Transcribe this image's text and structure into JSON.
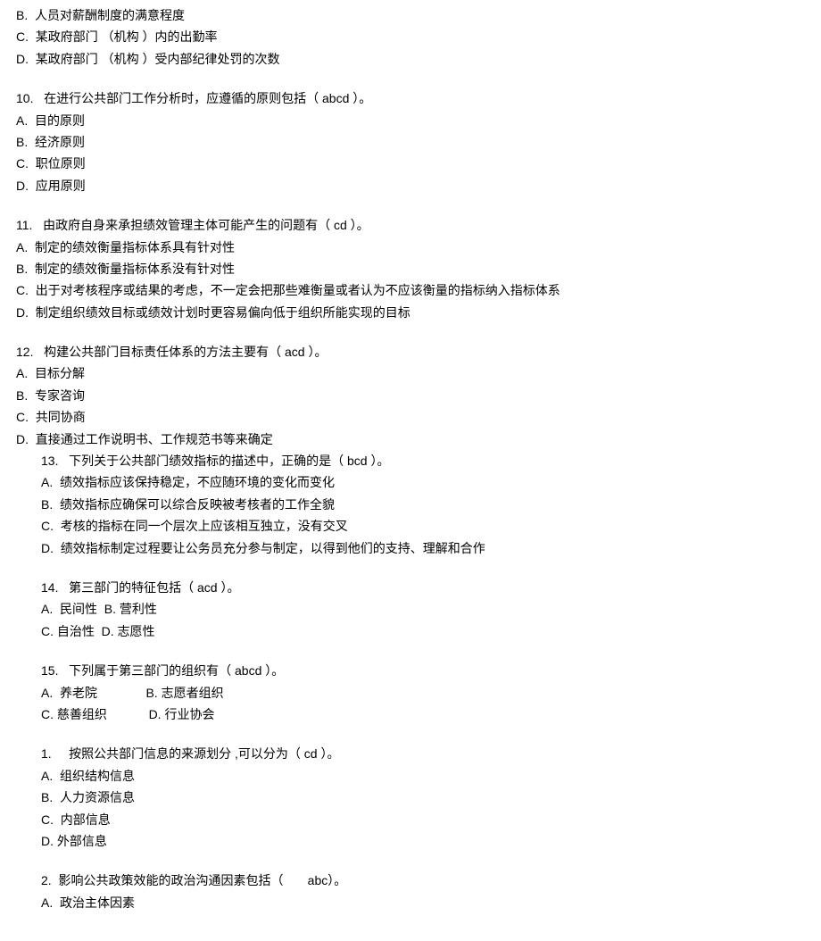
{
  "lines": [
    {
      "text": "B.  人员对薪酬制度的满意程度",
      "indent": false,
      "spacer": false
    },
    {
      "text": "C.  某政府部门 （机构 ）内的出勤率",
      "indent": false,
      "spacer": false
    },
    {
      "text": "D.  某政府部门 （机构 ）受内部纪律处罚的次数",
      "indent": false,
      "spacer": false
    },
    {
      "text": "",
      "indent": false,
      "spacer": true
    },
    {
      "text": "10.   在进行公共部门工作分析时，应遵循的原则包括（ abcd ）。",
      "indent": false,
      "spacer": false
    },
    {
      "text": "A.  目的原则",
      "indent": false,
      "spacer": false
    },
    {
      "text": "B.  经济原则",
      "indent": false,
      "spacer": false
    },
    {
      "text": "C.  职位原则",
      "indent": false,
      "spacer": false
    },
    {
      "text": "D.  应用原则",
      "indent": false,
      "spacer": false
    },
    {
      "text": "",
      "indent": false,
      "spacer": true
    },
    {
      "text": "11.   由政府自身来承担绩效管理主体可能产生的问题有（ cd ）。",
      "indent": false,
      "spacer": false
    },
    {
      "text": "A.  制定的绩效衡量指标体系具有针对性",
      "indent": false,
      "spacer": false
    },
    {
      "text": "B.  制定的绩效衡量指标体系没有针对性",
      "indent": false,
      "spacer": false
    },
    {
      "text": "C.  出于对考核程序或结果的考虑，不一定会把那些难衡量或者认为不应该衡量的指标纳入指标体系",
      "indent": false,
      "spacer": false
    },
    {
      "text": "D.  制定组织绩效目标或绩效计划时更容易偏向低于组织所能实现的目标",
      "indent": false,
      "spacer": false
    },
    {
      "text": "",
      "indent": false,
      "spacer": true
    },
    {
      "text": "12.   构建公共部门目标责任体系的方法主要有（ acd ）。",
      "indent": false,
      "spacer": false
    },
    {
      "text": "A.  目标分解",
      "indent": false,
      "spacer": false
    },
    {
      "text": "B.  专家咨询",
      "indent": false,
      "spacer": false
    },
    {
      "text": "C.  共同协商",
      "indent": false,
      "spacer": false
    },
    {
      "text": "D.  直接通过工作说明书、工作规范书等来确定",
      "indent": false,
      "spacer": false
    },
    {
      "text": "13.   下列关于公共部门绩效指标的描述中，正确的是（ bcd ）。",
      "indent": true,
      "spacer": false
    },
    {
      "text": "A.  绩效指标应该保持稳定，不应随环境的变化而变化",
      "indent": true,
      "spacer": false
    },
    {
      "text": "B.  绩效指标应确保可以综合反映被考核者的工作全貌",
      "indent": true,
      "spacer": false
    },
    {
      "text": "C.  考核的指标在同一个层次上应该相互独立，没有交叉",
      "indent": true,
      "spacer": false
    },
    {
      "text": "D.  绩效指标制定过程要让公务员充分参与制定，以得到他们的支持、理解和合作",
      "indent": true,
      "spacer": false
    },
    {
      "text": "",
      "indent": true,
      "spacer": true
    },
    {
      "text": "14.   第三部门的特征包括（ acd ）。",
      "indent": true,
      "spacer": false
    },
    {
      "text": "A.  民间性  B. 营利性",
      "indent": true,
      "spacer": false
    },
    {
      "text": "C. 自治性  D. 志愿性",
      "indent": true,
      "spacer": false
    },
    {
      "text": "",
      "indent": true,
      "spacer": true
    },
    {
      "text": "15.   下列属于第三部门的组织有（ abcd ）。",
      "indent": true,
      "spacer": false
    },
    {
      "text": "A.  养老院              B. 志愿者组织",
      "indent": true,
      "spacer": false
    },
    {
      "text": "C. 慈善组织            D. 行业协会",
      "indent": true,
      "spacer": false
    },
    {
      "text": "",
      "indent": true,
      "spacer": true
    },
    {
      "text": "1.     按照公共部门信息的来源划分 ,可以分为（ cd ）。",
      "indent": true,
      "spacer": false
    },
    {
      "text": "A.  组织结构信息",
      "indent": true,
      "spacer": false
    },
    {
      "text": "B.  人力资源信息",
      "indent": true,
      "spacer": false
    },
    {
      "text": "C.  内部信息",
      "indent": true,
      "spacer": false
    },
    {
      "text": "D. 外部信息",
      "indent": true,
      "spacer": false
    },
    {
      "text": "",
      "indent": true,
      "spacer": true
    },
    {
      "text": "2.  影响公共政策效能的政治沟通因素包括（       abc）。",
      "indent": true,
      "spacer": false
    },
    {
      "text": "A.  政治主体因素",
      "indent": true,
      "spacer": false
    }
  ]
}
